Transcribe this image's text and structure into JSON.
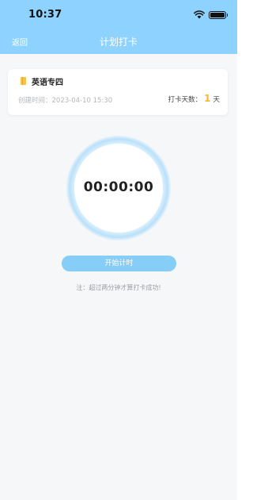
{
  "status_bar": {
    "time": "10:37"
  },
  "nav": {
    "back_label": "返回",
    "title": "计划打卡"
  },
  "card": {
    "icon": "book-icon",
    "course_name": "英语专四",
    "created_prefix": "创建时间：",
    "created_at": "2023-04-10 15:30",
    "days_label": "打卡天数：",
    "days_count": "1",
    "days_unit": "天"
  },
  "timer": {
    "display": "00:00:00"
  },
  "actions": {
    "start_label": "开始计时"
  },
  "note": "注：超过两分钟才算打卡成功!",
  "colors": {
    "header": "#8ed3ff",
    "button": "#86cdf7",
    "ring": "#bfe3fb",
    "accent_days": "#f7b733"
  }
}
